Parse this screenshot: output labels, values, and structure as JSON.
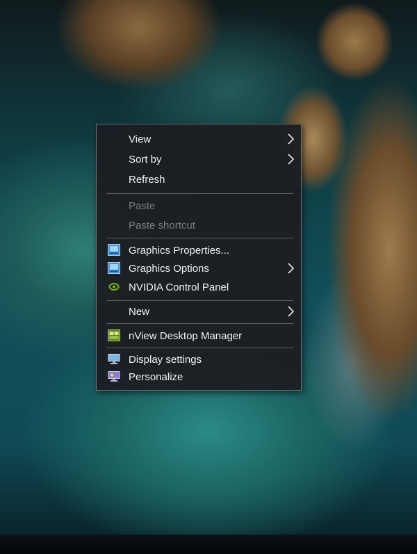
{
  "menu": {
    "items": [
      {
        "label": "View",
        "submenu": true,
        "disabled": false,
        "icon": ""
      },
      {
        "label": "Sort by",
        "submenu": true,
        "disabled": false,
        "icon": ""
      },
      {
        "label": "Refresh",
        "submenu": false,
        "disabled": false,
        "icon": ""
      },
      {
        "label": "Paste",
        "submenu": false,
        "disabled": true,
        "icon": ""
      },
      {
        "label": "Paste shortcut",
        "submenu": false,
        "disabled": true,
        "icon": ""
      },
      {
        "label": "Graphics Properties...",
        "submenu": false,
        "disabled": false,
        "icon": "intel-graphics-icon"
      },
      {
        "label": "Graphics Options",
        "submenu": true,
        "disabled": false,
        "icon": "intel-graphics-icon"
      },
      {
        "label": "NVIDIA Control Panel",
        "submenu": false,
        "disabled": false,
        "icon": "nvidia-icon"
      },
      {
        "label": "New",
        "submenu": true,
        "disabled": false,
        "icon": ""
      },
      {
        "label": "nView Desktop Manager",
        "submenu": false,
        "disabled": false,
        "icon": "nview-icon"
      },
      {
        "label": "Display settings",
        "submenu": false,
        "disabled": false,
        "icon": "display-settings-icon"
      },
      {
        "label": "Personalize",
        "submenu": false,
        "disabled": false,
        "icon": "personalize-icon"
      }
    ]
  },
  "colors": {
    "menu_background": "#1c1e22",
    "menu_text": "#f2f2f2",
    "disabled_text": "#7a7d80",
    "separator": "#5d6266"
  }
}
